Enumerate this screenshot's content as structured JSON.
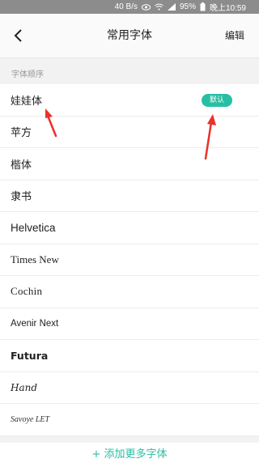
{
  "status_bar": {
    "network_speed": "40 B/s",
    "battery": "95%",
    "time": "晚上10:59",
    "icons": [
      "eye-icon",
      "wifi-icon",
      "signal-icon",
      "battery-icon"
    ]
  },
  "nav": {
    "title": "常用字体",
    "edit_label": "编辑",
    "back_icon": "chevron-left-icon"
  },
  "section": {
    "title": "字体顺序"
  },
  "fonts": [
    {
      "name": "娃娃体",
      "is_default": true
    },
    {
      "name": "苹方"
    },
    {
      "name": "楷体"
    },
    {
      "name": "隶书"
    },
    {
      "name": "Helvetica"
    },
    {
      "name": "Times New"
    },
    {
      "name": "Cochin"
    },
    {
      "name": "Avenir Next"
    },
    {
      "name": "Futura"
    },
    {
      "name": "Hand"
    },
    {
      "name": "Savoye LET"
    }
  ],
  "default_badge": "默认",
  "add_more": "+ 添加更多字体",
  "colors": {
    "accent": "#27bfa3",
    "annotation": "#e8322b",
    "status_bar": "#8c8c8c"
  }
}
